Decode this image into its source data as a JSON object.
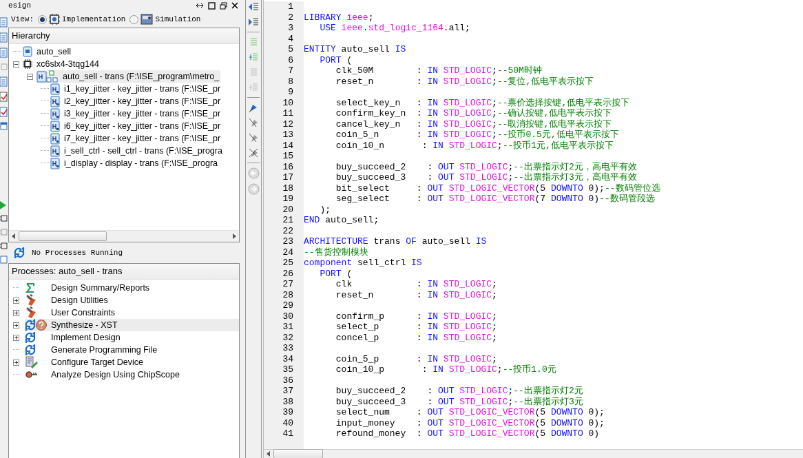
{
  "panel": {
    "title": "esign",
    "view_label": "View:",
    "views": [
      {
        "label": "Implementation",
        "kind": "impl",
        "selected": true
      },
      {
        "label": "Simulation",
        "kind": "sim",
        "selected": false
      }
    ]
  },
  "hierarchy": {
    "title": "Hierarchy",
    "tree": [
      {
        "label": "auto_sell",
        "kind": "file",
        "selected": false
      },
      {
        "label": "xc6slx4-3tqg144",
        "kind": "chip",
        "selected": false,
        "expanded": true,
        "children": [
          {
            "label": "auto_sell - trans (F:\\ISE_program\\metro_",
            "kind": "top",
            "selected": true,
            "expanded": true,
            "children": [
              {
                "label": "i1_key_jitter - key_jitter - trans (F:\\ISE_pr",
                "kind": "module",
                "selected": false
              },
              {
                "label": "i2_key_jitter - key_jitter - trans (F:\\ISE_pr",
                "kind": "module",
                "selected": false
              },
              {
                "label": "i3_key_jitter - key_jitter - trans (F:\\ISE_pr",
                "kind": "module",
                "selected": false
              },
              {
                "label": "i6_key_jitter - key_jitter - trans (F:\\ISE_pr",
                "kind": "module",
                "selected": false
              },
              {
                "label": "i7_key_jitter - key_jitter - trans (F:\\ISE_pr",
                "kind": "module",
                "selected": false
              },
              {
                "label": "i_sell_ctrl - sell_ctrl - trans (F:\\ISE_progra",
                "kind": "module",
                "selected": false
              },
              {
                "label": "i_display - display - trans (F:\\ISE_progra",
                "kind": "module",
                "selected": false
              }
            ]
          }
        ]
      }
    ]
  },
  "process_status": "No Processes Running",
  "processes": {
    "title": "Processes: auto_sell - trans",
    "items": [
      {
        "label": "Design Summary/Reports",
        "kind": "summary",
        "expandable": false,
        "selected": false
      },
      {
        "label": "Design Utilities",
        "kind": "tools",
        "expandable": true,
        "selected": false
      },
      {
        "label": "User Constraints",
        "kind": "tools",
        "expandable": true,
        "selected": false
      },
      {
        "label": "Synthesize - XST",
        "kind": "run-question",
        "expandable": true,
        "selected": true
      },
      {
        "label": "Implement Design",
        "kind": "run",
        "expandable": true,
        "selected": false
      },
      {
        "label": "Generate Programming File",
        "kind": "run",
        "expandable": false,
        "selected": false
      },
      {
        "label": "Configure Target Device",
        "kind": "device",
        "expandable": true,
        "selected": false
      },
      {
        "label": "Analyze Design Using ChipScope",
        "kind": "probe",
        "expandable": false,
        "selected": false
      }
    ]
  },
  "editor": {
    "lines": [
      {
        "number": "1"
      },
      {
        "number": "2",
        "tokens": [
          {
            "kind": "kw",
            "text": "LIBRARY"
          },
          {
            "kind": "ty",
            "text": " ieee"
          },
          {
            "kind": "tx",
            "text": ";"
          }
        ]
      },
      {
        "number": "3",
        "tokens": [
          {
            "kind": "kw",
            "text": "   USE"
          },
          {
            "kind": "ty",
            "text": " ieee"
          },
          {
            "kind": "tx",
            "text": "."
          },
          {
            "kind": "ty",
            "text": "std_logic_1164"
          },
          {
            "kind": "tx",
            "text": ".all;"
          }
        ]
      },
      {
        "number": "4"
      },
      {
        "number": "5",
        "tokens": [
          {
            "kind": "kw",
            "text": "ENTITY"
          },
          {
            "kind": "tx",
            "text": " auto_sell "
          },
          {
            "kind": "kw",
            "text": "IS"
          }
        ]
      },
      {
        "number": "6",
        "tokens": [
          {
            "kind": "kw",
            "text": "   PORT"
          },
          {
            "kind": "tx",
            "text": " ("
          }
        ]
      },
      {
        "number": "7",
        "tokens": [
          {
            "kind": "tx",
            "text": "      clk_50M        : "
          },
          {
            "kind": "kw",
            "text": "IN"
          },
          {
            "kind": "ty",
            "text": " STD_LOGIC"
          },
          {
            "kind": "tx",
            "text": ";"
          },
          {
            "kind": "cm",
            "text": "--50M时钟"
          }
        ]
      },
      {
        "number": "8",
        "tokens": [
          {
            "kind": "tx",
            "text": "      reset_n        : "
          },
          {
            "kind": "kw",
            "text": "IN"
          },
          {
            "kind": "ty",
            "text": " STD_LOGIC"
          },
          {
            "kind": "tx",
            "text": ";"
          },
          {
            "kind": "cm",
            "text": "--复位,低电平表示按下"
          }
        ]
      },
      {
        "number": "9"
      },
      {
        "number": "10",
        "tokens": [
          {
            "kind": "tx",
            "text": "      select_key_n   : "
          },
          {
            "kind": "kw",
            "text": "IN"
          },
          {
            "kind": "ty",
            "text": " STD_LOGIC"
          },
          {
            "kind": "tx",
            "text": ";"
          },
          {
            "kind": "cm",
            "text": "--票价选择按键,低电平表示按下"
          }
        ]
      },
      {
        "number": "11",
        "tokens": [
          {
            "kind": "tx",
            "text": "      confirm_key_n  : "
          },
          {
            "kind": "kw",
            "text": "IN"
          },
          {
            "kind": "ty",
            "text": " STD_LOGIC"
          },
          {
            "kind": "tx",
            "text": ";"
          },
          {
            "kind": "cm",
            "text": "--确认按键,低电平表示按下"
          }
        ]
      },
      {
        "number": "12",
        "tokens": [
          {
            "kind": "tx",
            "text": "      cancel_key_n   : "
          },
          {
            "kind": "kw",
            "text": "IN"
          },
          {
            "kind": "ty",
            "text": " STD_LOGIC"
          },
          {
            "kind": "tx",
            "text": ";"
          },
          {
            "kind": "cm",
            "text": "--取消按键,低电平表示按下"
          }
        ]
      },
      {
        "number": "13",
        "tokens": [
          {
            "kind": "tx",
            "text": "      coin_5_n       : "
          },
          {
            "kind": "kw",
            "text": "IN"
          },
          {
            "kind": "ty",
            "text": " STD_LOGIC"
          },
          {
            "kind": "tx",
            "text": ";"
          },
          {
            "kind": "cm",
            "text": "--投币0.5元,低电平表示按下"
          }
        ]
      },
      {
        "number": "14",
        "tokens": [
          {
            "kind": "tx",
            "text": "      coin_10_n       : "
          },
          {
            "kind": "kw",
            "text": "IN"
          },
          {
            "kind": "ty",
            "text": " STD_LOGIC"
          },
          {
            "kind": "tx",
            "text": ";"
          },
          {
            "kind": "cm",
            "text": "--投币1元,低电平表示按下"
          }
        ]
      },
      {
        "number": "15"
      },
      {
        "number": "16",
        "tokens": [
          {
            "kind": "tx",
            "text": "      buy_succeed_2    : "
          },
          {
            "kind": "kw",
            "text": "OUT"
          },
          {
            "kind": "ty",
            "text": " STD_LOGIC"
          },
          {
            "kind": "tx",
            "text": ";"
          },
          {
            "kind": "cm",
            "text": "--出票指示灯2元，高电平有效"
          }
        ]
      },
      {
        "number": "17",
        "tokens": [
          {
            "kind": "tx",
            "text": "      buy_succeed_3    : "
          },
          {
            "kind": "kw",
            "text": "OUT"
          },
          {
            "kind": "ty",
            "text": " STD_LOGIC"
          },
          {
            "kind": "tx",
            "text": ";"
          },
          {
            "kind": "cm",
            "text": "--出票指示灯3元，高电平有效"
          }
        ]
      },
      {
        "number": "18",
        "tokens": [
          {
            "kind": "tx",
            "text": "      bit_select     : "
          },
          {
            "kind": "kw",
            "text": "OUT"
          },
          {
            "kind": "ty",
            "text": " STD_LOGIC_VECTOR"
          },
          {
            "kind": "tx",
            "text": "(5 "
          },
          {
            "kind": "kw",
            "text": "DOWNTO"
          },
          {
            "kind": "tx",
            "text": " 0);"
          },
          {
            "kind": "cm",
            "text": "--数码管位选"
          }
        ]
      },
      {
        "number": "19",
        "tokens": [
          {
            "kind": "tx",
            "text": "      seg_select     : "
          },
          {
            "kind": "kw",
            "text": "OUT"
          },
          {
            "kind": "ty",
            "text": " STD_LOGIC_VECTOR"
          },
          {
            "kind": "tx",
            "text": "(7 "
          },
          {
            "kind": "kw",
            "text": "DOWNTO"
          },
          {
            "kind": "tx",
            "text": " 0)"
          },
          {
            "kind": "cm",
            "text": "--数码管段选"
          }
        ]
      },
      {
        "number": "20",
        "tokens": [
          {
            "kind": "tx",
            "text": "   );"
          }
        ]
      },
      {
        "number": "21",
        "tokens": [
          {
            "kind": "kw",
            "text": "END"
          },
          {
            "kind": "tx",
            "text": " auto_sell;"
          }
        ]
      },
      {
        "number": "22"
      },
      {
        "number": "23",
        "tokens": [
          {
            "kind": "kw",
            "text": "ARCHITECTURE"
          },
          {
            "kind": "tx",
            "text": " trans "
          },
          {
            "kind": "kw",
            "text": "OF"
          },
          {
            "kind": "tx",
            "text": " auto_sell "
          },
          {
            "kind": "kw",
            "text": "IS"
          }
        ]
      },
      {
        "number": "24",
        "tokens": [
          {
            "kind": "cm",
            "text": "--售货控制模块"
          }
        ]
      },
      {
        "number": "25",
        "tokens": [
          {
            "kind": "kw",
            "text": "component"
          },
          {
            "kind": "tx",
            "text": " sell_ctrl "
          },
          {
            "kind": "kw",
            "text": "IS"
          }
        ]
      },
      {
        "number": "26",
        "tokens": [
          {
            "kind": "kw",
            "text": "   PORT"
          },
          {
            "kind": "tx",
            "text": " ("
          }
        ]
      },
      {
        "number": "27",
        "tokens": [
          {
            "kind": "tx",
            "text": "      clk            : "
          },
          {
            "kind": "kw",
            "text": "IN"
          },
          {
            "kind": "ty",
            "text": " STD_LOGIC"
          },
          {
            "kind": "tx",
            "text": ";"
          }
        ]
      },
      {
        "number": "28",
        "tokens": [
          {
            "kind": "tx",
            "text": "      reset_n        : "
          },
          {
            "kind": "kw",
            "text": "IN"
          },
          {
            "kind": "ty",
            "text": " STD_LOGIC"
          },
          {
            "kind": "tx",
            "text": ";"
          }
        ]
      },
      {
        "number": "29"
      },
      {
        "number": "30",
        "tokens": [
          {
            "kind": "tx",
            "text": "      confirm_p      : "
          },
          {
            "kind": "kw",
            "text": "IN"
          },
          {
            "kind": "ty",
            "text": " STD_LOGIC"
          },
          {
            "kind": "tx",
            "text": ";"
          }
        ]
      },
      {
        "number": "31",
        "tokens": [
          {
            "kind": "tx",
            "text": "      select_p       : "
          },
          {
            "kind": "kw",
            "text": "IN"
          },
          {
            "kind": "ty",
            "text": " STD_LOGIC"
          },
          {
            "kind": "tx",
            "text": ";"
          }
        ]
      },
      {
        "number": "32",
        "tokens": [
          {
            "kind": "tx",
            "text": "      concel_p       : "
          },
          {
            "kind": "kw",
            "text": "IN"
          },
          {
            "kind": "ty",
            "text": " STD_LOGIC"
          },
          {
            "kind": "tx",
            "text": ";"
          }
        ]
      },
      {
        "number": "33"
      },
      {
        "number": "34",
        "tokens": [
          {
            "kind": "tx",
            "text": "      coin_5_p       : "
          },
          {
            "kind": "kw",
            "text": "IN"
          },
          {
            "kind": "ty",
            "text": " STD_LOGIC"
          },
          {
            "kind": "tx",
            "text": ";"
          }
        ]
      },
      {
        "number": "35",
        "tokens": [
          {
            "kind": "tx",
            "text": "      coin_10_p       : "
          },
          {
            "kind": "kw",
            "text": "IN"
          },
          {
            "kind": "ty",
            "text": " STD_LOGIC"
          },
          {
            "kind": "tx",
            "text": ";"
          },
          {
            "kind": "cm",
            "text": "--投币1.0元"
          }
        ]
      },
      {
        "number": "36"
      },
      {
        "number": "37",
        "tokens": [
          {
            "kind": "tx",
            "text": "      buy_succeed_2    : "
          },
          {
            "kind": "kw",
            "text": "OUT"
          },
          {
            "kind": "ty",
            "text": " STD_LOGIC"
          },
          {
            "kind": "tx",
            "text": ";"
          },
          {
            "kind": "cm",
            "text": "--出票指示灯2元"
          }
        ]
      },
      {
        "number": "38",
        "tokens": [
          {
            "kind": "tx",
            "text": "      buy_succeed_3    : "
          },
          {
            "kind": "kw",
            "text": "OUT"
          },
          {
            "kind": "ty",
            "text": " STD_LOGIC"
          },
          {
            "kind": "tx",
            "text": ";"
          },
          {
            "kind": "cm",
            "text": "--出票指示灯3元"
          }
        ]
      },
      {
        "number": "39",
        "tokens": [
          {
            "kind": "tx",
            "text": "      select_num     : "
          },
          {
            "kind": "kw",
            "text": "OUT"
          },
          {
            "kind": "ty",
            "text": " STD_LOGIC_VECTOR"
          },
          {
            "kind": "tx",
            "text": "(5 "
          },
          {
            "kind": "kw",
            "text": "DOWNTO"
          },
          {
            "kind": "tx",
            "text": " 0);"
          }
        ]
      },
      {
        "number": "40",
        "tokens": [
          {
            "kind": "tx",
            "text": "      input_money    : "
          },
          {
            "kind": "kw",
            "text": "OUT"
          },
          {
            "kind": "ty",
            "text": " STD_LOGIC_VECTOR"
          },
          {
            "kind": "tx",
            "text": "(5 "
          },
          {
            "kind": "kw",
            "text": "DOWNTO"
          },
          {
            "kind": "tx",
            "text": " 0);"
          }
        ]
      },
      {
        "number": "41",
        "tokens": [
          {
            "kind": "tx",
            "text": "      refound_money  : "
          },
          {
            "kind": "kw",
            "text": "OUT"
          },
          {
            "kind": "ty",
            "text": " STD_LOGIC_VECTOR"
          },
          {
            "kind": "tx",
            "text": "(5 "
          },
          {
            "kind": "kw",
            "text": "DOWNTO"
          },
          {
            "kind": "tx",
            "text": " 0)"
          }
        ]
      }
    ]
  }
}
